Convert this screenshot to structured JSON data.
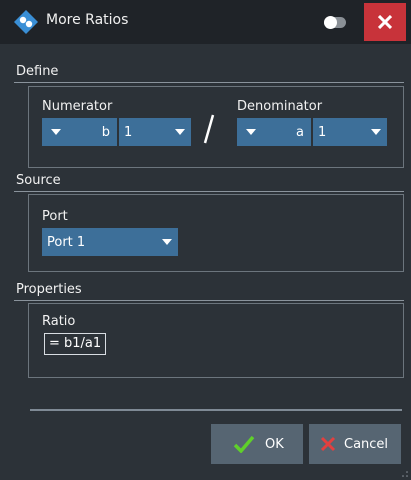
{
  "window": {
    "title": "More Ratios",
    "logo_icon": "rohde-schwarz-logo",
    "toggle_icon": "toggle-switch",
    "close_icon": "close-icon",
    "close_color": "#c8333a"
  },
  "define": {
    "label": "Define",
    "numerator": {
      "label": "Numerator",
      "wave": "b",
      "port": "1"
    },
    "separator": "/",
    "denominator": {
      "label": "Denominator",
      "wave": "a",
      "port": "1"
    }
  },
  "source": {
    "label": "Source",
    "port_label": "Port",
    "port_value": "Port 1"
  },
  "properties": {
    "label": "Properties",
    "ratio_label": "Ratio",
    "ratio_value": "= b1/a1"
  },
  "buttons": {
    "ok": "OK",
    "cancel": "Cancel"
  },
  "colors": {
    "dropdown": "#3d6f99",
    "ok_check": "#5fd02a",
    "cancel_x": "#e2403f"
  }
}
